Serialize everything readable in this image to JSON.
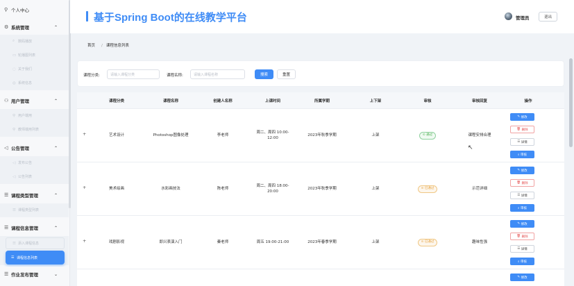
{
  "app": {
    "title": "基于Spring Boot的在线教学平台"
  },
  "header": {
    "user_name": "管理员",
    "logout_label": "退出"
  },
  "breadcrumb": {
    "home": "首页",
    "separator": "/",
    "current": "课程信息列表"
  },
  "sidebar": {
    "top_item": "个人中心",
    "groups": [
      {
        "label": "系统管理",
        "sub": [
          "数码播放",
          "轮播图列表",
          "关于我们",
          "系统信息"
        ]
      },
      {
        "label": "用户管理",
        "sub": [
          "用户端用",
          "教师端用列表"
        ]
      },
      {
        "label": "公告管理",
        "sub": [
          "发布公告",
          "公告列表"
        ]
      },
      {
        "label": "课程类型管理",
        "sub": [
          "课程类型列表"
        ]
      },
      {
        "label": "课程信息管理",
        "sub": [
          "添入课程信息",
          "课程信息列表"
        ]
      },
      {
        "label": "作业发布管理",
        "sub": []
      }
    ]
  },
  "search": {
    "category_label": "课程分类:",
    "category_placeholder": "请输入课程分类",
    "name_label": "课程名称:",
    "name_placeholder": "请输入课程名称",
    "search_button": "搜索",
    "reset_button": "重置"
  },
  "table": {
    "columns": [
      "课程分类",
      "课程名称",
      "创建人名称",
      "上课时间",
      "所属学期",
      "上下架",
      "审核",
      "审核回复",
      "操作"
    ],
    "rows": [
      {
        "expand": "+",
        "category": "艺术设计",
        "name": "Photoshop图像处理",
        "creator": "李老师",
        "time": "周二、周四 10:00-12:00",
        "term": "2023年秋季学期",
        "shelf": "上架",
        "audit": "通过",
        "reply": "课程安排合理"
      },
      {
        "expand": "+",
        "category": "美术绘画",
        "name": "水彩画技法",
        "creator": "陈老师",
        "time": "周二、周四 18:00-20:00",
        "term": "2023年秋季学期",
        "shelf": "上架",
        "audit": "已通过",
        "reply": "示范详细"
      },
      {
        "expand": "+",
        "category": "戏剧影视",
        "name": "即兴表演入门",
        "creator": "秦老师",
        "time": "周五 19:00-21:00",
        "term": "2023年春季学期",
        "shelf": "上架",
        "audit": "已通过",
        "reply": "趣味性强"
      }
    ],
    "actions": {
      "edit": "修改",
      "delete": "删除",
      "detail": "详情",
      "review": "审核"
    }
  },
  "colors": {
    "accent": "#3f8cf6",
    "pass": "#4caf50",
    "pending": "#e6a23c",
    "danger": "#e55353"
  },
  "icons": [
    "user-icon",
    "gear-icon",
    "users-icon",
    "megaphone-icon",
    "list-icon",
    "chevron-up-icon",
    "chevron-down-icon",
    "edit-icon",
    "trash-icon",
    "detail-icon",
    "search-icon",
    "check-circle-icon",
    "clock-icon"
  ]
}
